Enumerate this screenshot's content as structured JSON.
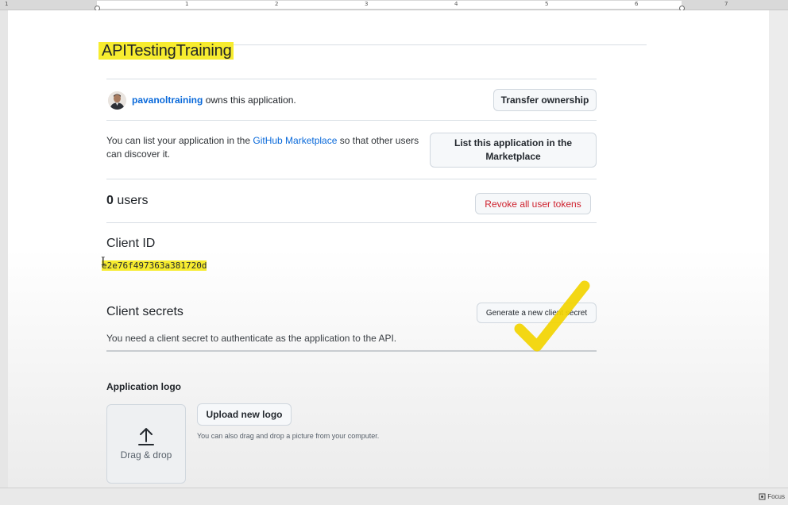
{
  "ruler": {
    "numbers": [
      "1",
      "1",
      "2",
      "3",
      "4",
      "5",
      "6",
      "7"
    ]
  },
  "app": {
    "title": "APITestingTraining",
    "owner_name": "pavanoltraining",
    "owner_suffix": "owns this application.",
    "transfer_button": "Transfer ownership"
  },
  "marketplace": {
    "text_before": "You can list your application in the",
    "link": "GitHub Marketplace",
    "text_after": "so that other users can discover it.",
    "button": "List this application in the Marketplace"
  },
  "users": {
    "count": "0",
    "label": "users",
    "revoke_button": "Revoke all user tokens"
  },
  "client_id": {
    "label": "Client ID",
    "value": "e2e76f497363a381720d"
  },
  "client_secrets": {
    "label": "Client secrets",
    "button": "Generate a new client secret",
    "description": "You need a client secret to authenticate as the application to the API."
  },
  "logo": {
    "label": "Application logo",
    "dropzone": "Drag & drop",
    "upload_button": "Upload new logo",
    "hint": "You can also drag and drop a picture from your computer."
  },
  "taskbar": {
    "focus": "Focus"
  },
  "colors": {
    "highlight": "#f7ec2f",
    "link": "#0969da",
    "danger": "#cf222e",
    "checkmark": "#f2d400"
  }
}
